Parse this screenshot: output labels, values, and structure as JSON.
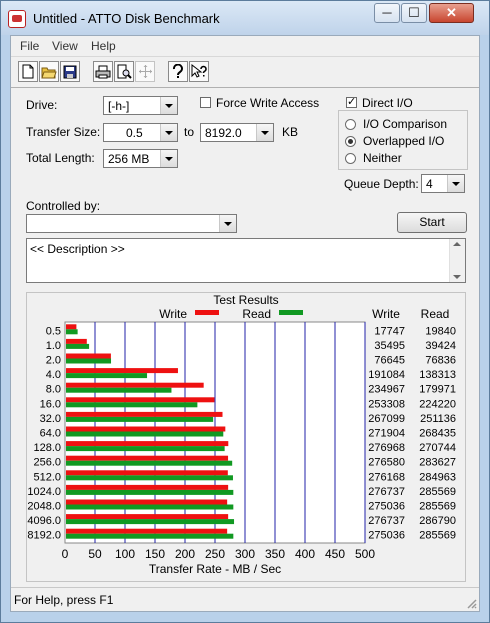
{
  "window": {
    "title": "Untitled - ATTO Disk Benchmark",
    "minimize_glyph": "─",
    "maximize_glyph": "☐",
    "close_glyph": "✕"
  },
  "menu": [
    "File",
    "View",
    "Help"
  ],
  "toolbar_icons": [
    "new-icon",
    "open-icon",
    "save-icon",
    "print-icon",
    "print-preview-icon",
    "move-icon",
    "help-icon",
    "context-help-icon"
  ],
  "settings": {
    "drive_label": "Drive:",
    "drive_value": "[-h-]",
    "force_write_access_label": "Force Write Access",
    "force_write_access_checked": false,
    "direct_io_label": "Direct I/O",
    "direct_io_checked": true,
    "transfer_size_label": "Transfer Size:",
    "transfer_size_from": "0.5",
    "to_label": "to",
    "transfer_size_to": "8192.0",
    "kb_label": "KB",
    "total_length_label": "Total Length:",
    "total_length_value": "256 MB",
    "io_comparison_label": "I/O Comparison",
    "overlapped_io_label": "Overlapped I/O",
    "neither_label": "Neither",
    "selected_mode": "Overlapped I/O",
    "queue_depth_label": "Queue Depth:",
    "queue_depth_value": "4",
    "controlled_by_label": "Controlled by:",
    "controlled_by_value": "",
    "start_label": "Start",
    "description_text": "<< Description >>"
  },
  "chart_data": {
    "type": "bar",
    "title": "Test Results",
    "legend": [
      "Write",
      "Read"
    ],
    "colors": {
      "write": "#ee1111",
      "read": "#119922",
      "grid": "#2222aa"
    },
    "categories": [
      "0.5",
      "1.0",
      "2.0",
      "4.0",
      "8.0",
      "16.0",
      "32.0",
      "64.0",
      "128.0",
      "256.0",
      "512.0",
      "1024.0",
      "2048.0",
      "4096.0",
      "8192.0"
    ],
    "series": [
      {
        "name": "Write",
        "values": [
          17747,
          35495,
          76645,
          191084,
          234967,
          253308,
          267099,
          271904,
          276968,
          276580,
          276168,
          276737,
          275036,
          276737,
          275036
        ]
      },
      {
        "name": "Read",
        "values": [
          19840,
          39424,
          76836,
          138313,
          179971,
          224220,
          251136,
          268435,
          270744,
          283627,
          284963,
          285569,
          285569,
          286790,
          285569
        ]
      }
    ],
    "xlabel": "Transfer Rate - MB / Sec",
    "xticks": [
      "0",
      "50",
      "100",
      "150",
      "200",
      "250",
      "300",
      "350",
      "400",
      "450",
      "500"
    ],
    "xlim": [
      0,
      500
    ],
    "columns": [
      "Write",
      "Read"
    ]
  },
  "status": {
    "text": "For Help, press F1"
  }
}
